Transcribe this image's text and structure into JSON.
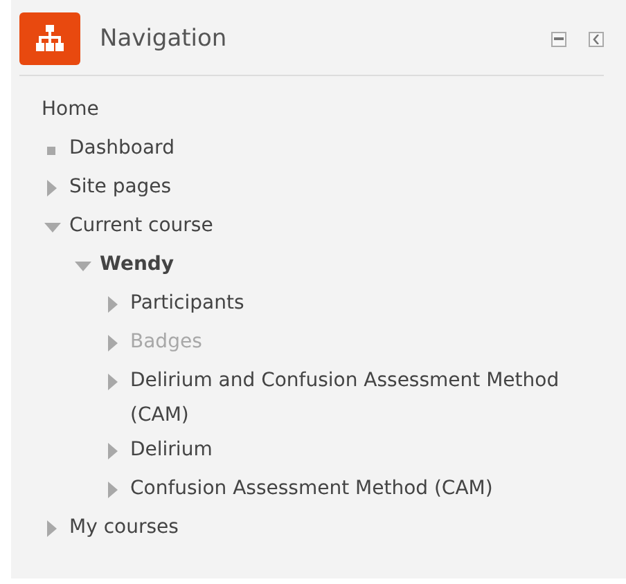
{
  "block": {
    "title": "Navigation"
  },
  "tree": [
    {
      "label": "Home",
      "kind": "root",
      "active": false,
      "disabled": false
    },
    {
      "label": "Dashboard",
      "kind": "leaf",
      "active": false,
      "disabled": false
    },
    {
      "label": "Site pages",
      "kind": "collapsed",
      "active": false,
      "disabled": false
    },
    {
      "label": "Current course",
      "kind": "expanded",
      "active": false,
      "disabled": false,
      "children": [
        {
          "label": "Wendy",
          "kind": "expanded",
          "active": true,
          "disabled": false,
          "children": [
            {
              "label": "Participants",
              "kind": "collapsed",
              "active": false,
              "disabled": false
            },
            {
              "label": "Badges",
              "kind": "collapsed",
              "active": false,
              "disabled": true
            },
            {
              "label": "Delirium and Confusion Assessment Method (CAM)",
              "kind": "collapsed",
              "active": false,
              "disabled": false
            },
            {
              "label": "Delirium",
              "kind": "collapsed",
              "active": false,
              "disabled": false
            },
            {
              "label": "Confusion Assessment Method (CAM)",
              "kind": "collapsed",
              "active": false,
              "disabled": false
            }
          ]
        }
      ]
    },
    {
      "label": "My courses",
      "kind": "collapsed",
      "active": false,
      "disabled": false
    }
  ]
}
